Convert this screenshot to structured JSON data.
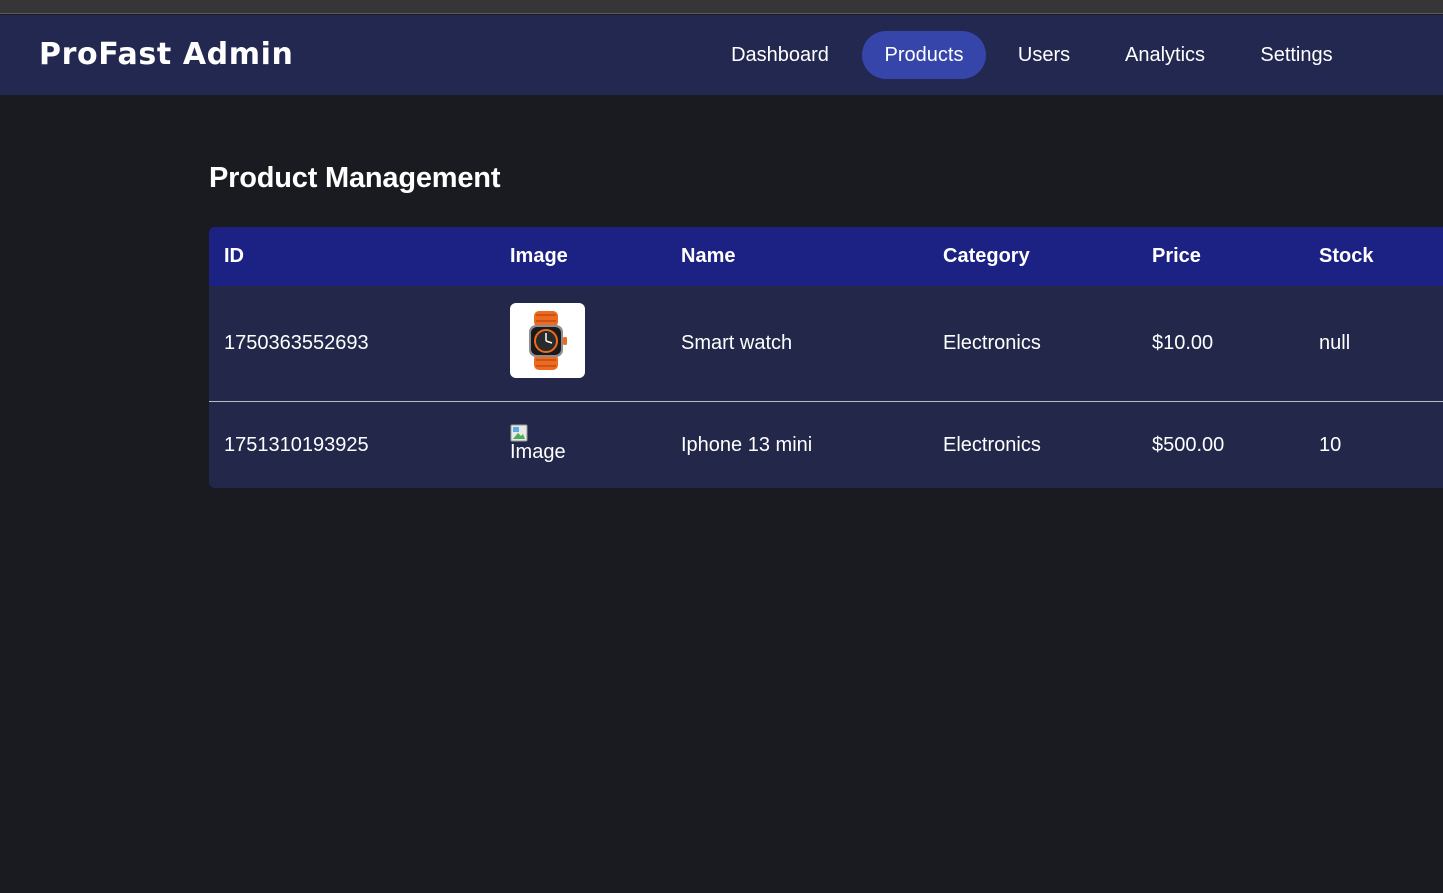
{
  "header": {
    "brand": "ProFast Admin",
    "nav": [
      {
        "label": "Dashboard",
        "active": false
      },
      {
        "label": "Products",
        "active": true
      },
      {
        "label": "Users",
        "active": false
      },
      {
        "label": "Analytics",
        "active": false
      },
      {
        "label": "Settings",
        "active": false
      }
    ]
  },
  "main": {
    "title": "Product Management",
    "table": {
      "columns": [
        "ID",
        "Image",
        "Name",
        "Category",
        "Price",
        "Stock"
      ],
      "rows": [
        {
          "id": "1750363552693",
          "image": {
            "type": "thumbnail",
            "icon": "smartwatch-icon"
          },
          "name": "Smart watch",
          "category": "Electronics",
          "price": "$10.00",
          "stock": "null"
        },
        {
          "id": "1751310193925",
          "image": {
            "type": "broken",
            "alt": "Image",
            "icon": "broken-image-icon"
          },
          "name": "Iphone 13 mini",
          "category": "Electronics",
          "price": "$500.00",
          "stock": "10"
        }
      ]
    }
  },
  "colors": {
    "background": "#1a1b20",
    "navbar": "#232850",
    "nav_active": "#3545a9",
    "table_header": "#1b2283",
    "table_body": "#23284b",
    "watch_band": "#f06a1e"
  }
}
